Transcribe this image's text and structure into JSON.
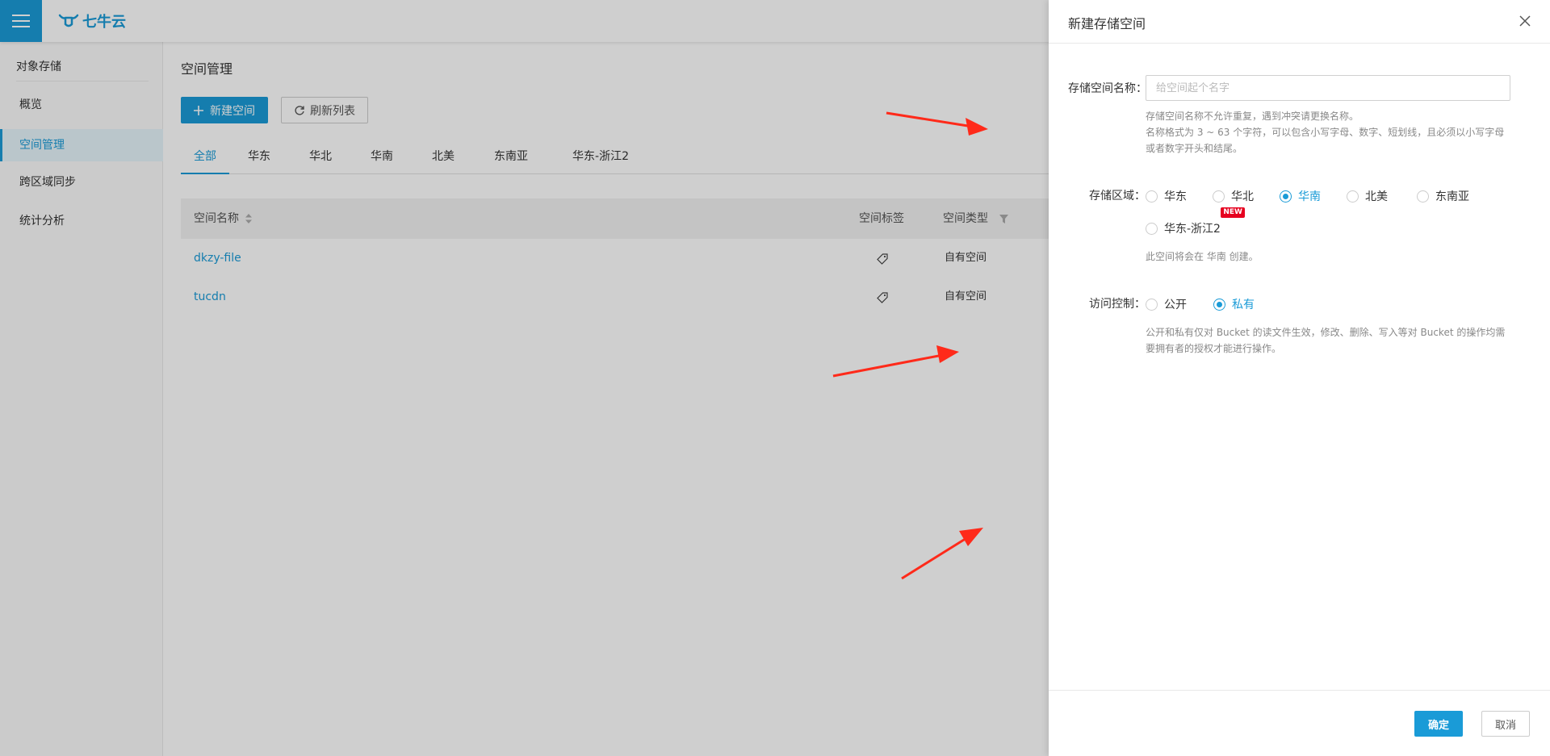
{
  "topbar": {
    "logo_text": "七牛云"
  },
  "sidebar": {
    "section_title": "对象存储",
    "items": [
      {
        "label": "概览",
        "active": false
      },
      {
        "label": "空间管理",
        "active": true
      },
      {
        "label": "跨区域同步",
        "active": false
      },
      {
        "label": "统计分析",
        "active": false
      }
    ]
  },
  "main": {
    "page_title": "空间管理",
    "new_bucket_label": "新建空间",
    "refresh_label": "刷新列表",
    "tabs": [
      {
        "label": "全部",
        "active": true
      },
      {
        "label": "华东"
      },
      {
        "label": "华北"
      },
      {
        "label": "华南"
      },
      {
        "label": "北美"
      },
      {
        "label": "东南亚"
      },
      {
        "label": "华东-浙江2"
      }
    ],
    "table": {
      "columns": [
        "空间名称",
        "空间标签",
        "空间类型"
      ],
      "rows": [
        {
          "name": "dkzy-file",
          "type": "自有空间"
        },
        {
          "name": "tucdn",
          "type": "自有空间"
        }
      ]
    }
  },
  "drawer": {
    "title": "新建存储空间",
    "name_label": "存储空间名称：",
    "name_placeholder": "给空间起个名字",
    "name_value": "",
    "name_help_1": "存储空间名称不允许重复，遇到冲突请更换名称。",
    "name_help_2": "名称格式为 3 ~ 63 个字符，可以包含小写字母、数字、短划线，且必须以小写字母或者数字开头和结尾。",
    "region_label": "存储区域：",
    "regions": [
      {
        "label": "华东",
        "checked": false
      },
      {
        "label": "华北",
        "checked": false
      },
      {
        "label": "华南",
        "checked": true
      },
      {
        "label": "北美",
        "checked": false
      },
      {
        "label": "东南亚",
        "checked": false
      },
      {
        "label": "华东-浙江2",
        "checked": false,
        "badge": "NEW"
      }
    ],
    "region_help": "此空间将会在 华南 创建。",
    "access_label": "访问控制：",
    "access_options": [
      {
        "label": "公开",
        "checked": false
      },
      {
        "label": "私有",
        "checked": true
      }
    ],
    "access_help": "公开和私有仅对 Bucket 的读文件生效，修改、删除、写入等对 Bucket 的操作均需要拥有者的授权才能进行操作。",
    "ok_label": "确定",
    "cancel_label": "取消"
  },
  "colors": {
    "accent": "#1a9bd7",
    "badge": "#e6001f",
    "arrow": "#ff2a1a"
  }
}
